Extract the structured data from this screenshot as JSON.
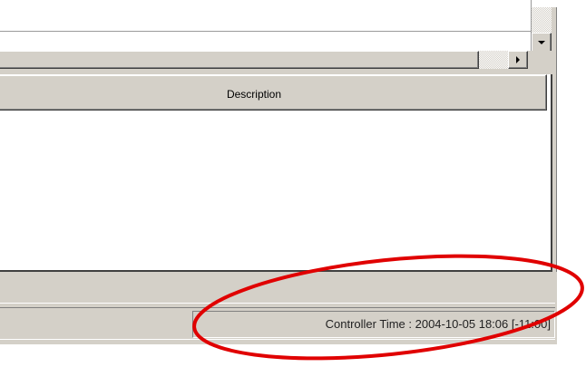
{
  "table": {
    "columns": [
      {
        "label": "Description"
      }
    ],
    "rows": []
  },
  "status_bar": {
    "controller_time": "Controller Time : 2004-10-05 18:06 [-11:00]"
  },
  "icons": {
    "scroll_down": "arrow-down-icon",
    "scroll_right": "arrow-right-icon"
  },
  "colors": {
    "annotation": "#e00000",
    "window_face": "#d4d0c8"
  }
}
